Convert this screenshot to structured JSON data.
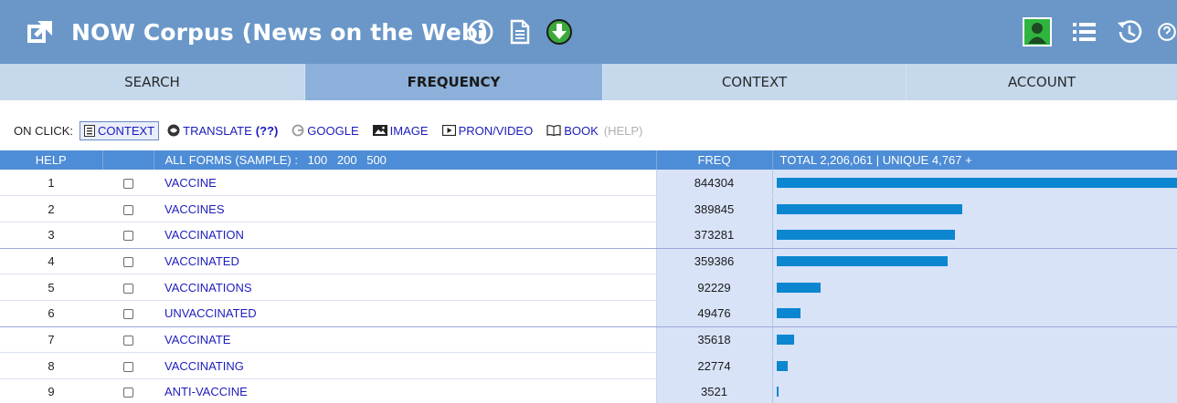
{
  "header": {
    "title": "NOW Corpus (News on the Web)",
    "icons": [
      "external-link-icon",
      "info-icon",
      "document-icon",
      "download-icon",
      "user-icon",
      "list-icon",
      "history-icon",
      "help-icon"
    ],
    "bg_color": "#6a97c8"
  },
  "tabs": [
    {
      "label": "SEARCH",
      "active": false
    },
    {
      "label": "FREQUENCY",
      "active": true
    },
    {
      "label": "CONTEXT",
      "active": false
    },
    {
      "label": "ACCOUNT",
      "active": false
    }
  ],
  "on_click": {
    "label": "ON CLICK:",
    "items": [
      {
        "label": "CONTEXT",
        "icon": "context-icon",
        "selected": true
      },
      {
        "label": "TRANSLATE",
        "extra": "(??)",
        "icon": "translate-icon"
      },
      {
        "label": "GOOGLE",
        "icon": "google-icon"
      },
      {
        "label": "IMAGE",
        "icon": "image-icon"
      },
      {
        "label": "PRON/VIDEO",
        "icon": "video-icon"
      },
      {
        "label": "BOOK",
        "icon": "book-icon"
      }
    ],
    "help": "(HELP)"
  },
  "table": {
    "headers": {
      "help": "HELP",
      "all_forms": "ALL FORMS (SAMPLE) :",
      "sample_sizes": [
        "100",
        "200",
        "500"
      ],
      "freq": "FREQ",
      "total": "TOTAL 2,206,061  |  UNIQUE 4,767  +"
    },
    "rows": [
      {
        "num": "1",
        "word": "VACCINE",
        "freq": "844304",
        "value": 844304
      },
      {
        "num": "2",
        "word": "VACCINES",
        "freq": "389845",
        "value": 389845
      },
      {
        "num": "3",
        "word": "VACCINATION",
        "freq": "373281",
        "value": 373281
      },
      {
        "num": "4",
        "word": "VACCINATED",
        "freq": "359386",
        "value": 359386
      },
      {
        "num": "5",
        "word": "VACCINATIONS",
        "freq": "92229",
        "value": 92229
      },
      {
        "num": "6",
        "word": "UNVACCINATED",
        "freq": "49476",
        "value": 49476
      },
      {
        "num": "7",
        "word": "VACCINATE",
        "freq": "35618",
        "value": 35618
      },
      {
        "num": "8",
        "word": "VACCINATING",
        "freq": "22774",
        "value": 22774
      },
      {
        "num": "9",
        "word": "ANTI-VACCINE",
        "freq": "3521",
        "value": 3521
      }
    ],
    "max_value": 844304,
    "bar_color": "#0c86d0"
  }
}
